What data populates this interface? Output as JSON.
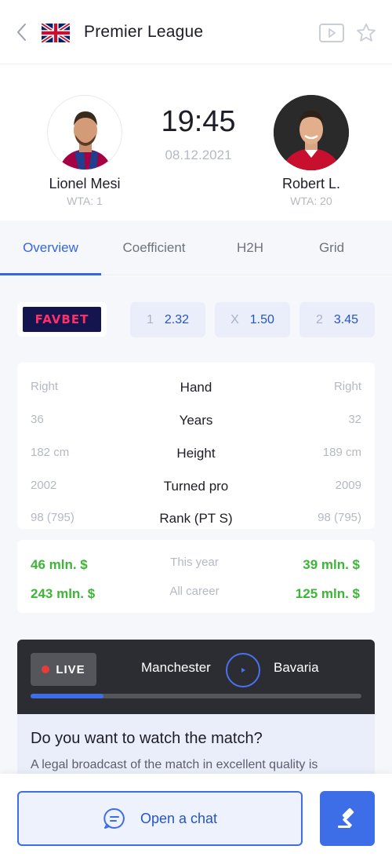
{
  "header": {
    "title": "Premier League",
    "flag": "uk-flag-icon"
  },
  "match": {
    "time": "19:45",
    "date": "08.12.2021",
    "player_left": {
      "name": "Lionel Mesi",
      "sub": "WTA: 1"
    },
    "player_right": {
      "name": "Robert L.",
      "sub": "WTA: 20"
    }
  },
  "tabs": [
    {
      "label": "Overview",
      "active": true
    },
    {
      "label": "Coefficient",
      "active": false
    },
    {
      "label": "H2H",
      "active": false
    },
    {
      "label": "Grid",
      "active": false
    }
  ],
  "odds": {
    "bookmaker": "FAVBET",
    "items": [
      {
        "key": "1",
        "value": "2.32"
      },
      {
        "key": "X",
        "value": "1.50"
      },
      {
        "key": "2",
        "value": "3.45"
      }
    ]
  },
  "stats": [
    {
      "left": "Right",
      "label": "Hand",
      "right": "Right"
    },
    {
      "left": "36",
      "label": "Years",
      "right": "32"
    },
    {
      "left": "182 cm",
      "label": "Height",
      "right": "189 cm"
    },
    {
      "left": "2002",
      "label": "Turned pro",
      "right": "2009"
    },
    {
      "left": "98 (795)",
      "label": "Rank (PT S)",
      "right": "98 (795)"
    }
  ],
  "earnings": [
    {
      "left": "46 mln. $",
      "label": "This year",
      "right": "39 mln. $"
    },
    {
      "left": "243 mln. $",
      "label": "All career",
      "right": "125 mln. $"
    }
  ],
  "live": {
    "badge": "LIVE",
    "team_a": "Manchester",
    "team_b": "Bavaria",
    "progress": 0.22
  },
  "watch": {
    "title": "Do you want to watch the match?",
    "desc": "A legal broadcast of the match in excellent quality is"
  },
  "bottom": {
    "chat_label": "Open a chat"
  },
  "colors": {
    "accent": "#3d6ee8",
    "positive": "#3db536",
    "live_dot": "#ea3b3b"
  }
}
